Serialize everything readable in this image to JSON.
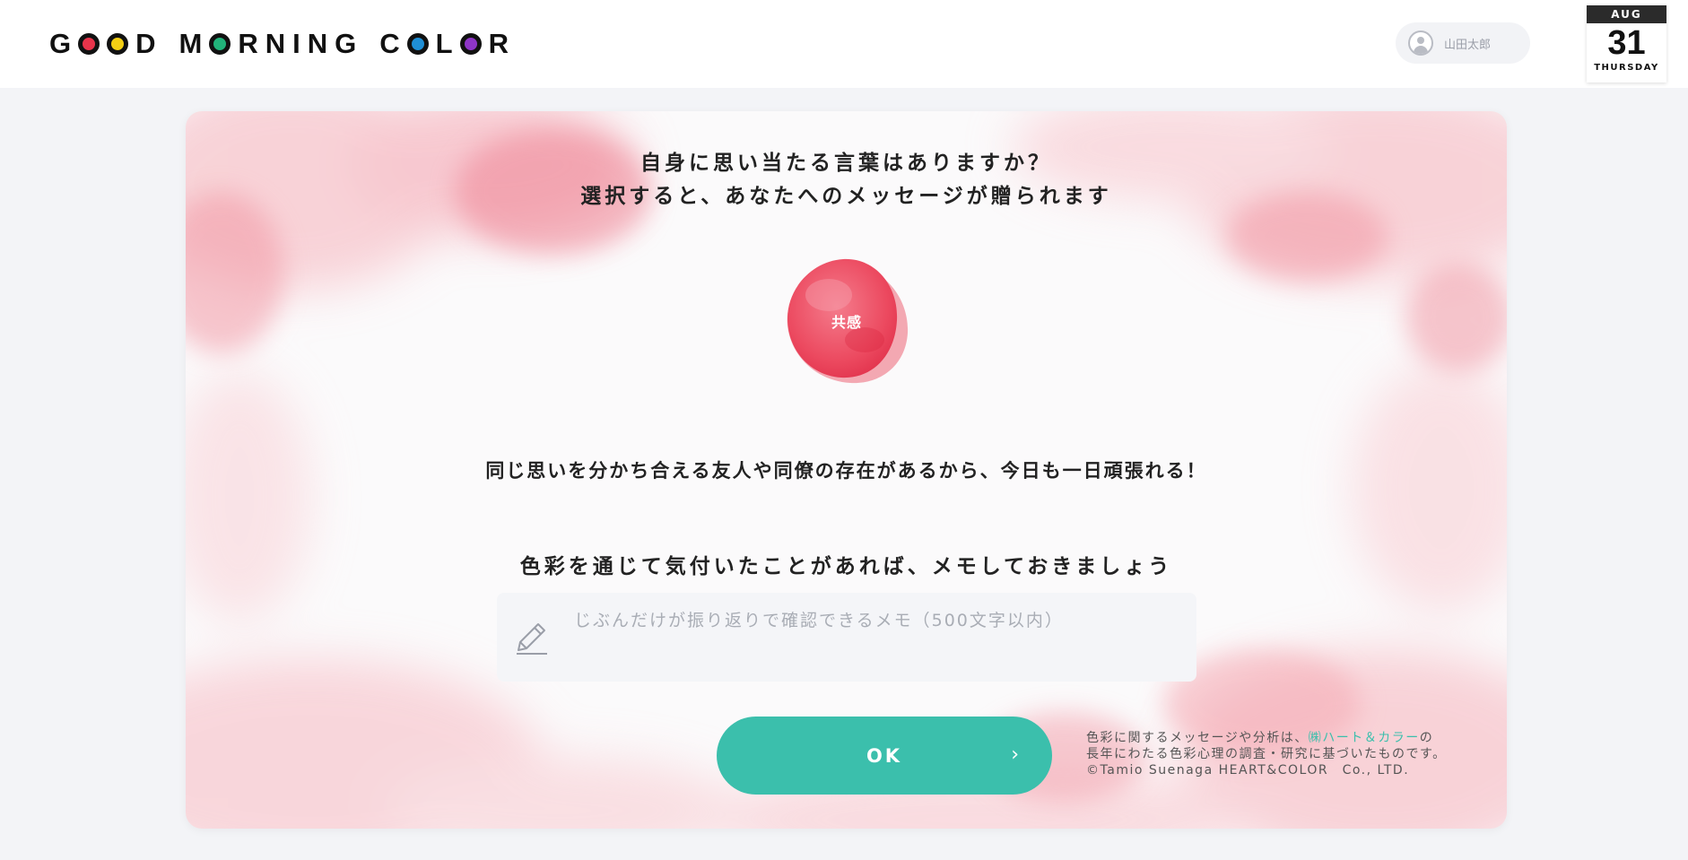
{
  "header": {
    "logo_words": [
      "GOOD",
      "MORNING",
      "COLOR"
    ],
    "logo_dot_colors": [
      "#e8344b",
      "#f4cf14",
      "#21b37a",
      "#1f8fd6",
      "#8e35c7"
    ],
    "user_name": "山田太郎",
    "user_icon": "user-avatar-icon",
    "calendar": {
      "month": "AUG",
      "day": "31",
      "weekday": "THURSDAY"
    }
  },
  "main": {
    "question_line1": "自身に思い当たる言葉はありますか？",
    "question_line2": "選択すると、あなたへのメッセージが贈られます",
    "selected_word": "共感",
    "selected_color": "#ec4a60",
    "message": "同じ思いを分かち合える友人や同僚の存在があるから、今日も一日頑張れる！",
    "memo_title": "色彩を通じて気付いたことがあれば、メモしておきましょう",
    "memo": {
      "placeholder": "じぶんだけが振り返りで確認できるメモ（500文字以内）",
      "value": "",
      "icon": "pencil-icon"
    },
    "ok_label": "OK",
    "ok_icon": "chevron-right-icon",
    "credits": {
      "line1_prefix": "色彩に関するメッセージや分析は、",
      "line1_link": "㈱ハート＆カラー",
      "line1_suffix": "の",
      "line2": "長年にわたる色彩心理の調査・研究に基づいたものです。",
      "line3": "©Tamio Suenaga HEART&COLOR　Co., LTD."
    }
  },
  "colors": {
    "accent": "#3bbfac",
    "watercolor": "#f4a7b1"
  }
}
